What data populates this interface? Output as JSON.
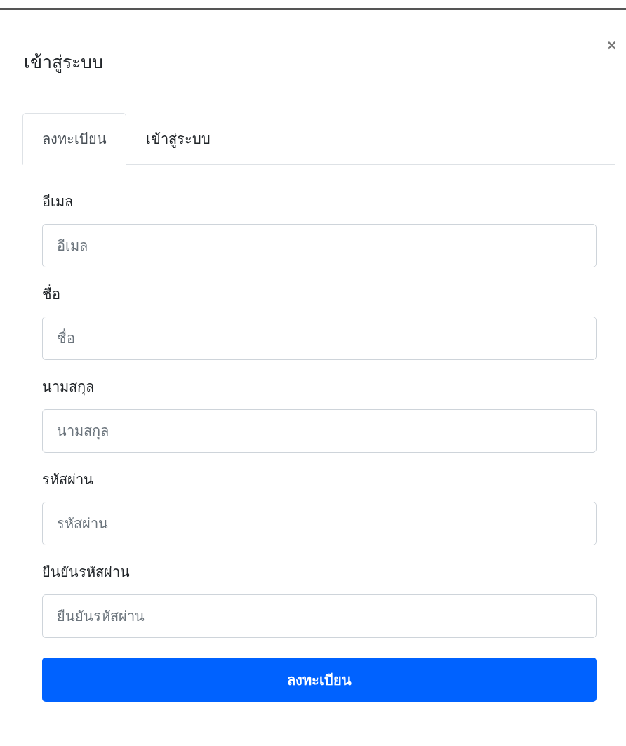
{
  "dialog": {
    "title": "เข้าสู่ระบบ",
    "close": "×"
  },
  "tabs": [
    {
      "label": "ลงทะเบียน",
      "selected": true
    },
    {
      "label": "เข้าสู่ระบบ",
      "selected": false
    }
  ],
  "fields": [
    {
      "label": "อีเมล",
      "placeholder": "อีเมล"
    },
    {
      "label": "ชื่อ",
      "placeholder": "ชื่อ"
    },
    {
      "label": "นามสกุล",
      "placeholder": "นามสกุล"
    },
    {
      "label": "รหัสผ่าน",
      "placeholder": "รหัสผ่าน"
    },
    {
      "label": "ยืนยันรหัสผ่าน",
      "placeholder": "ยืนยันรหัสผ่าน"
    }
  ],
  "submit": "ลงทะเบียน"
}
